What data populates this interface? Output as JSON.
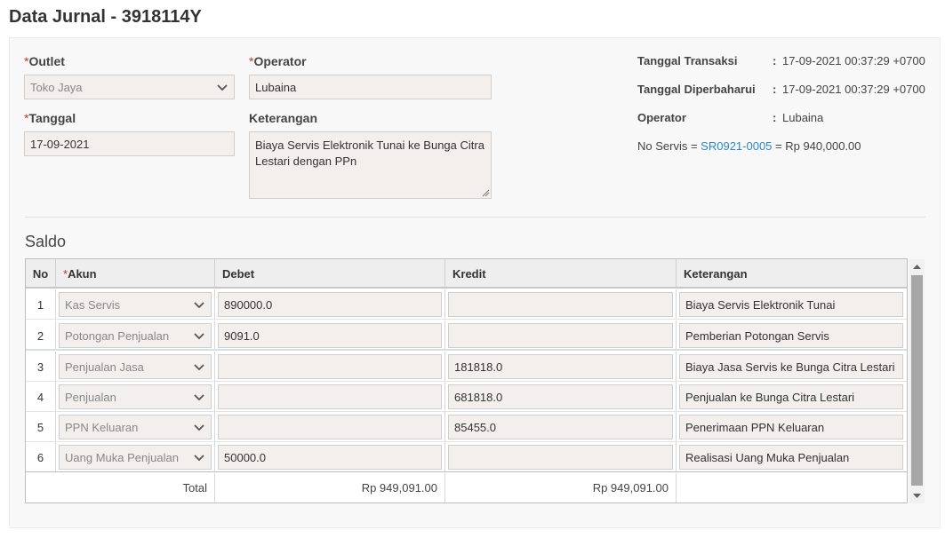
{
  "page": {
    "title": "Data Jurnal - 3918114Y"
  },
  "form": {
    "required_mark": "*",
    "outlet": {
      "label": "Outlet",
      "value": "Toko Jaya"
    },
    "operator": {
      "label": "Operator",
      "value": "Lubaina"
    },
    "tanggal": {
      "label": "Tanggal",
      "value": "17-09-2021"
    },
    "keterangan": {
      "label": "Keterangan",
      "value": "Biaya Servis Elektronik Tunai ke Bunga Citra Lestari dengan PPn"
    }
  },
  "info": {
    "colon": ":",
    "tanggal_transaksi": {
      "label": "Tanggal Transaksi",
      "value": "17-09-2021 00:37:29 +0700"
    },
    "tanggal_diperbaharui": {
      "label": "Tanggal Diperbaharui",
      "value": "17-09-2021 00:37:29 +0700"
    },
    "operator": {
      "label": "Operator",
      "value": "Lubaina"
    },
    "no_servis": {
      "prefix": "No Servis = ",
      "link": "SR0921-0005",
      "suffix": " = Rp 940,000.00"
    }
  },
  "saldo": {
    "title": "Saldo",
    "columns": {
      "no": "No",
      "akun": "Akun",
      "debet": "Debet",
      "kredit": "Kredit",
      "keterangan": "Keterangan"
    },
    "rows": [
      {
        "no": "1",
        "akun": "Kas Servis",
        "debet": "890000.0",
        "kredit": "",
        "keterangan": "Biaya Servis Elektronik Tunai"
      },
      {
        "no": "2",
        "akun": "Potongan Penjualan",
        "debet": "9091.0",
        "kredit": "",
        "keterangan": "Pemberian Potongan Servis"
      },
      {
        "no": "3",
        "akun": "Penjualan Jasa",
        "debet": "",
        "kredit": "181818.0",
        "keterangan": "Biaya Jasa Servis ke Bunga Citra Lestari"
      },
      {
        "no": "4",
        "akun": "Penjualan",
        "debet": "",
        "kredit": "681818.0",
        "keterangan": "Penjualan ke Bunga Citra Lestari"
      },
      {
        "no": "5",
        "akun": "PPN Keluaran",
        "debet": "",
        "kredit": "85455.0",
        "keterangan": "Penerimaan PPN Keluaran"
      },
      {
        "no": "6",
        "akun": "Uang Muka Penjualan",
        "debet": "50000.0",
        "kredit": "",
        "keterangan": "Realisasi Uang Muka Penjualan"
      }
    ],
    "total": {
      "label": "Total",
      "debet": "Rp 949,091.00",
      "kredit": "Rp 949,091.00"
    }
  },
  "colors": {
    "link": "#2b88c7",
    "required": "#c0392b",
    "field_bg": "#f3efec"
  }
}
